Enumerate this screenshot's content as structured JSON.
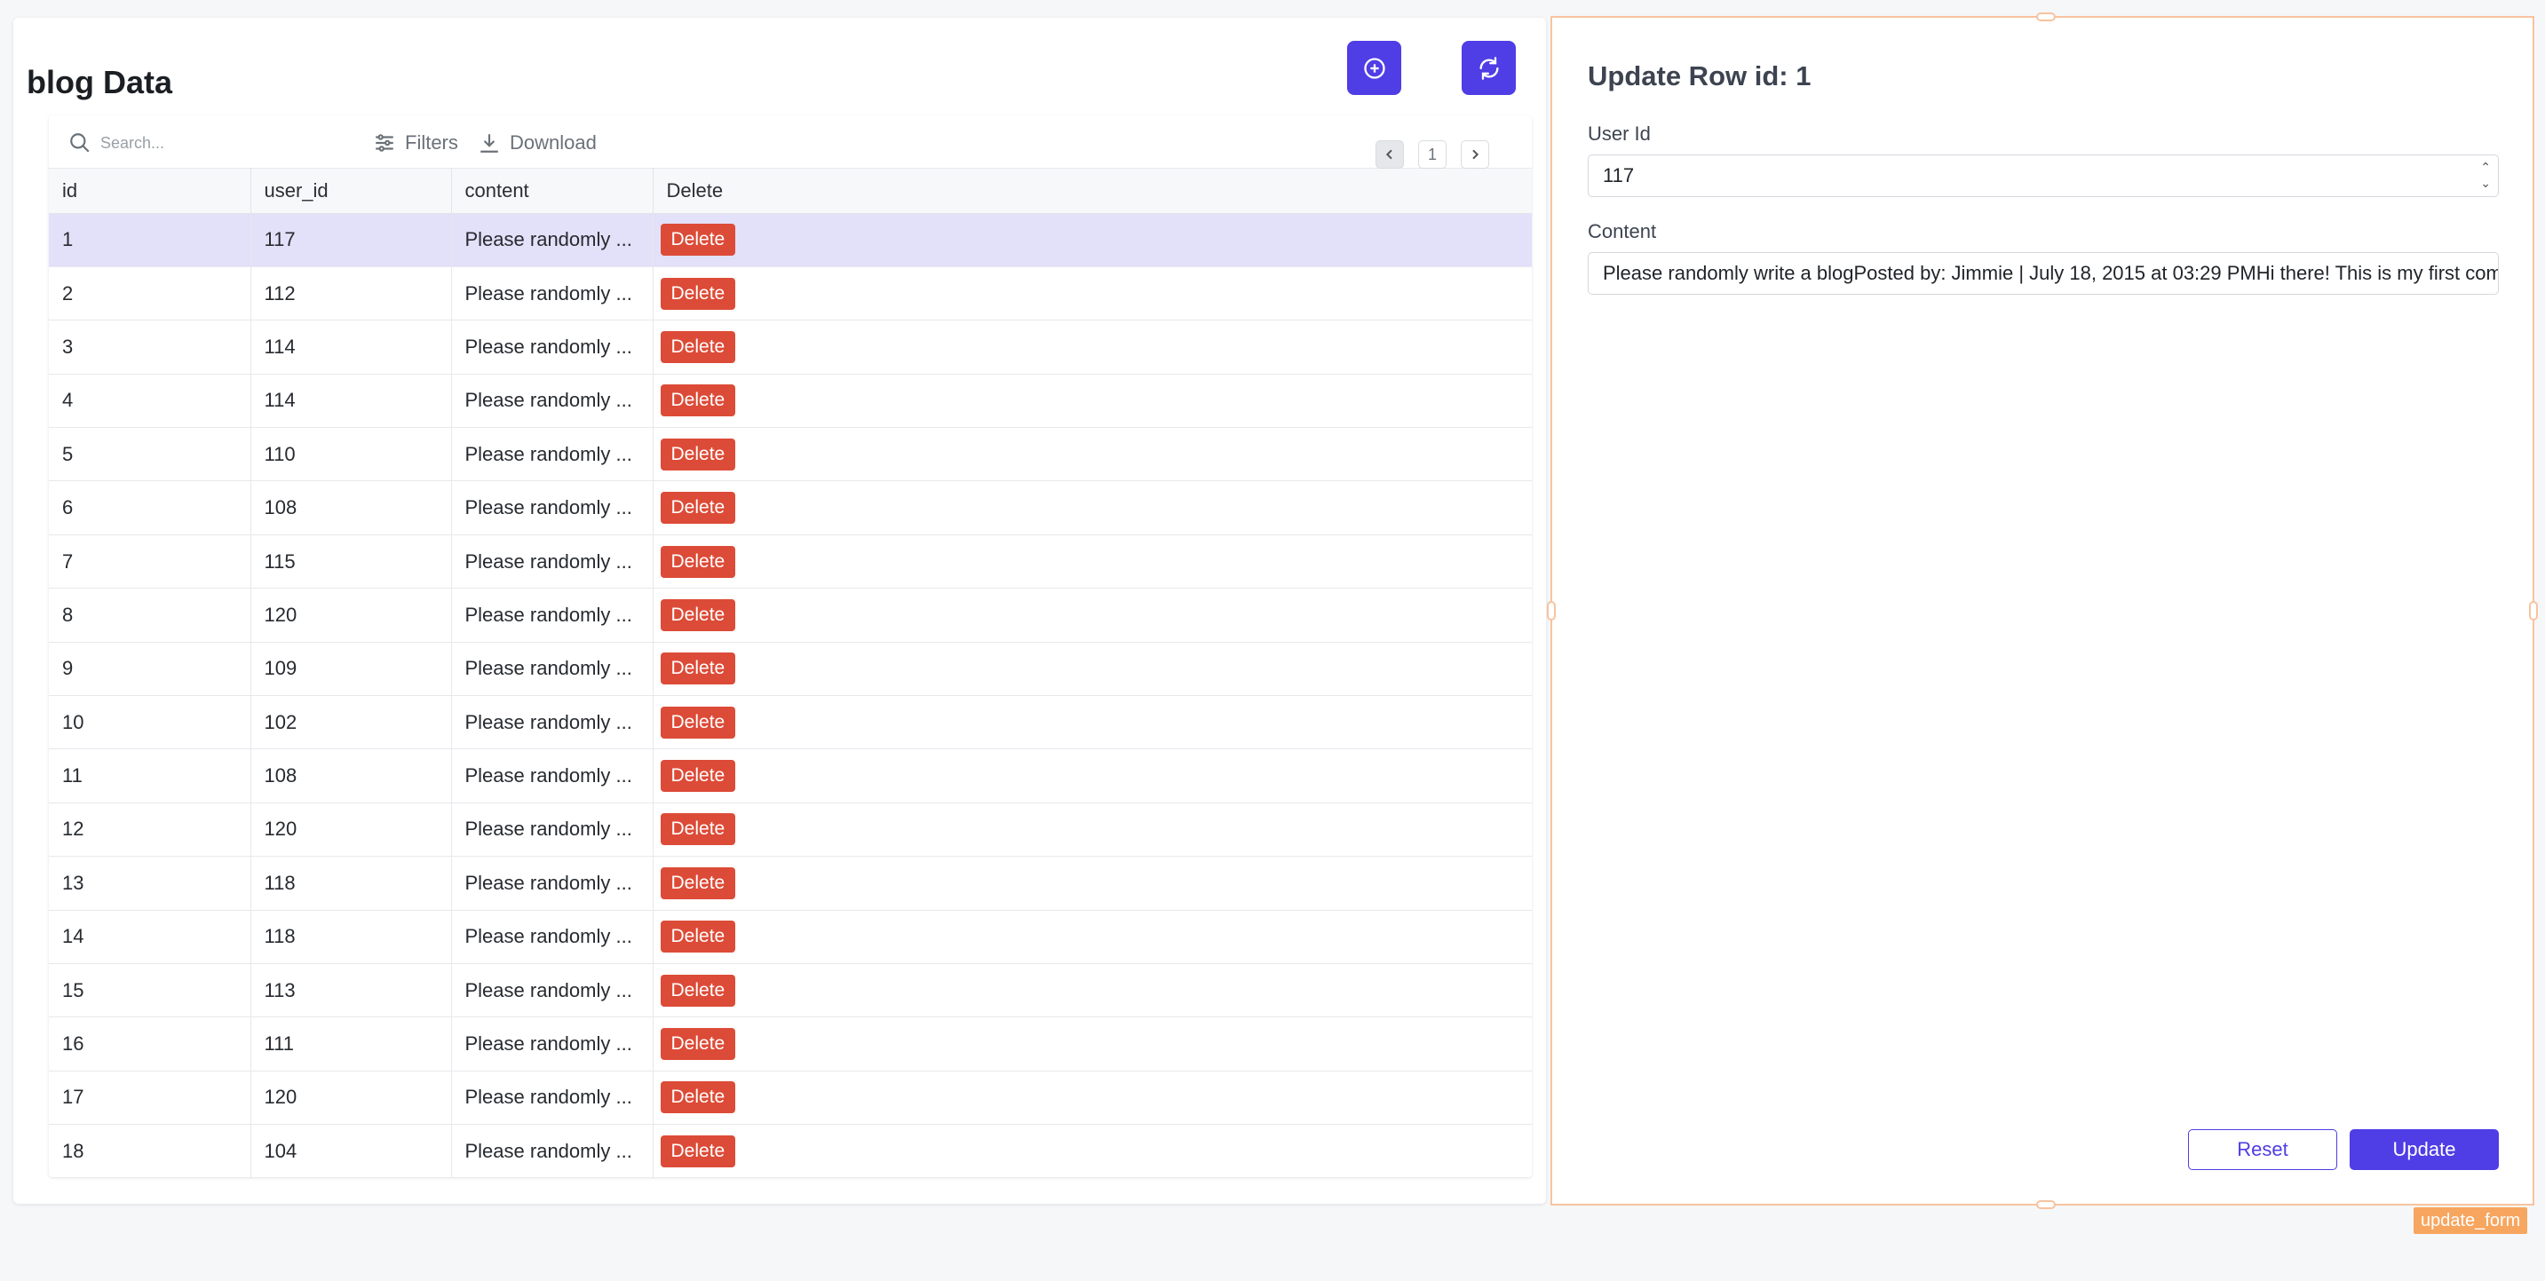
{
  "page": {
    "title": "blog Data"
  },
  "toolbar": {
    "search_placeholder": "Search...",
    "filters_label": "Filters",
    "download_label": "Download",
    "page_number": "1"
  },
  "table": {
    "columns": [
      "id",
      "user_id",
      "content",
      "Delete"
    ],
    "delete_label": "Delete",
    "rows": [
      {
        "id": "1",
        "user_id": "117",
        "content": "Please randomly ..."
      },
      {
        "id": "2",
        "user_id": "112",
        "content": "Please randomly ..."
      },
      {
        "id": "3",
        "user_id": "114",
        "content": "Please randomly ..."
      },
      {
        "id": "4",
        "user_id": "114",
        "content": "Please randomly ..."
      },
      {
        "id": "5",
        "user_id": "110",
        "content": "Please randomly ..."
      },
      {
        "id": "6",
        "user_id": "108",
        "content": "Please randomly ..."
      },
      {
        "id": "7",
        "user_id": "115",
        "content": "Please randomly ..."
      },
      {
        "id": "8",
        "user_id": "120",
        "content": "Please randomly ..."
      },
      {
        "id": "9",
        "user_id": "109",
        "content": "Please randomly ..."
      },
      {
        "id": "10",
        "user_id": "102",
        "content": "Please randomly ..."
      },
      {
        "id": "11",
        "user_id": "108",
        "content": "Please randomly ..."
      },
      {
        "id": "12",
        "user_id": "120",
        "content": "Please randomly ..."
      },
      {
        "id": "13",
        "user_id": "118",
        "content": "Please randomly ..."
      },
      {
        "id": "14",
        "user_id": "118",
        "content": "Please randomly ..."
      },
      {
        "id": "15",
        "user_id": "113",
        "content": "Please randomly ..."
      },
      {
        "id": "16",
        "user_id": "111",
        "content": "Please randomly ..."
      },
      {
        "id": "17",
        "user_id": "120",
        "content": "Please randomly ..."
      },
      {
        "id": "18",
        "user_id": "104",
        "content": "Please randomly ..."
      }
    ],
    "selected_row": "1"
  },
  "form": {
    "title": "Update Row id: 1",
    "user_id_label": "User Id",
    "user_id_value": "117",
    "content_label": "Content",
    "content_value": "Please randomly write a blogPosted by: Jimmie | July 18, 2015 at 03:29 PMHi there! This is my first comm",
    "reset_label": "Reset",
    "update_label": "Update",
    "component_tag": "update_form"
  },
  "colors": {
    "accent": "#4f3de6",
    "danger": "#dc4b37",
    "selected_row": "#e3e0f9",
    "panel_border": "#f7c39f"
  },
  "icons": [
    "plus-circle-icon",
    "refresh-icon",
    "search-icon",
    "filters-icon",
    "download-icon",
    "chevron-left-icon",
    "chevron-right-icon"
  ]
}
